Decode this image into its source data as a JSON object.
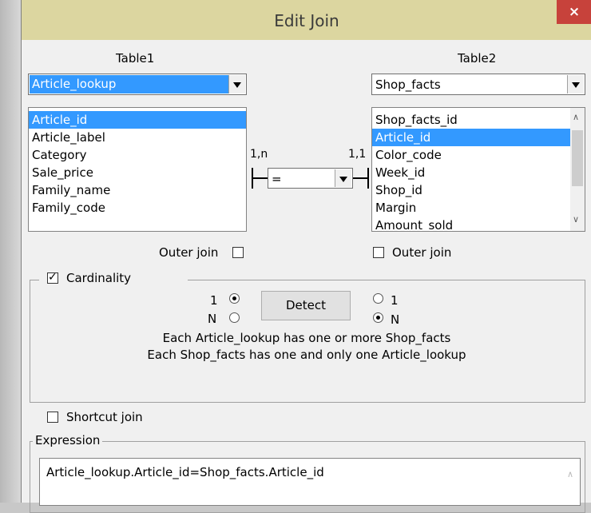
{
  "window": {
    "title": "Edit Join",
    "close_label": "×"
  },
  "table1": {
    "heading": "Table1",
    "selected_table": "Article_lookup",
    "columns": [
      {
        "label": "Article_id",
        "selected": true
      },
      {
        "label": "Article_label",
        "selected": false
      },
      {
        "label": "Category",
        "selected": false
      },
      {
        "label": "Sale_price",
        "selected": false
      },
      {
        "label": "Family_name",
        "selected": false
      },
      {
        "label": "Family_code",
        "selected": false
      }
    ],
    "outer_join_label": "Outer join",
    "outer_join_checked": false
  },
  "table2": {
    "heading": "Table2",
    "selected_table": "Shop_facts",
    "columns": [
      {
        "label": "Shop_facts_id",
        "selected": false
      },
      {
        "label": "Article_id",
        "selected": true
      },
      {
        "label": "Color_code",
        "selected": false
      },
      {
        "label": "Week_id",
        "selected": false
      },
      {
        "label": "Shop_id",
        "selected": false
      },
      {
        "label": "Margin",
        "selected": false
      },
      {
        "label": "Amount_sold",
        "selected": false
      }
    ],
    "outer_join_label": "Outer join",
    "outer_join_checked": false
  },
  "join": {
    "left_cardinality": "1,n",
    "right_cardinality": "1,1",
    "operator": "="
  },
  "cardinality": {
    "label": "Cardinality",
    "checked": true,
    "left_one": "1",
    "left_n": "N",
    "right_one": "1",
    "right_n": "N",
    "left_selected": "1",
    "right_selected": "N",
    "detect_label": "Detect",
    "description_line1": "Each Article_lookup has one or more Shop_facts",
    "description_line2": "Each Shop_facts has one and only one Article_lookup"
  },
  "shortcut_join": {
    "label": "Shortcut join",
    "checked": false
  },
  "expression": {
    "label": "Expression",
    "value": "Article_lookup.Article_id=Shop_facts.Article_id"
  }
}
